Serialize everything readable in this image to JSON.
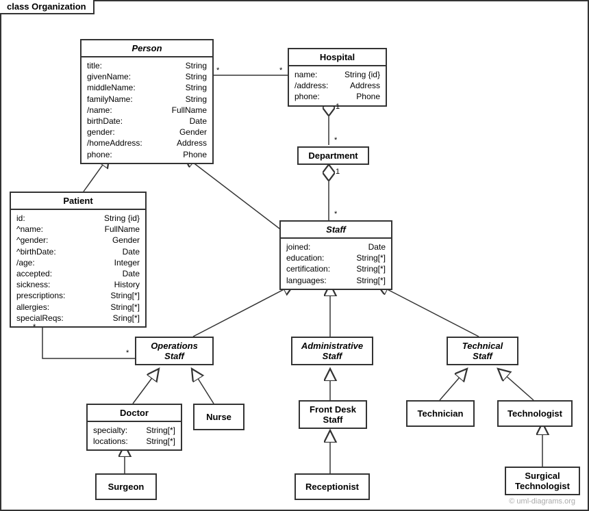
{
  "frame": {
    "title": "class Organization"
  },
  "watermark": "© uml-diagrams.org",
  "classes": {
    "person": {
      "name": "Person",
      "abstract": true,
      "attrs": [
        {
          "n": "title:",
          "t": "String"
        },
        {
          "n": "givenName:",
          "t": "String"
        },
        {
          "n": "middleName:",
          "t": "String"
        },
        {
          "n": "familyName:",
          "t": "String"
        },
        {
          "n": "/name:",
          "t": "FullName"
        },
        {
          "n": "birthDate:",
          "t": "Date"
        },
        {
          "n": "gender:",
          "t": "Gender"
        },
        {
          "n": "/homeAddress:",
          "t": "Address"
        },
        {
          "n": "phone:",
          "t": "Phone"
        }
      ]
    },
    "hospital": {
      "name": "Hospital",
      "attrs": [
        {
          "n": "name:",
          "t": "String {id}"
        },
        {
          "n": "/address:",
          "t": "Address"
        },
        {
          "n": "phone:",
          "t": "Phone"
        }
      ]
    },
    "department": {
      "name": "Department"
    },
    "patient": {
      "name": "Patient",
      "attrs": [
        {
          "n": "id:",
          "t": "String {id}"
        },
        {
          "n": "^name:",
          "t": "FullName"
        },
        {
          "n": "^gender:",
          "t": "Gender"
        },
        {
          "n": "^birthDate:",
          "t": "Date"
        },
        {
          "n": "/age:",
          "t": "Integer"
        },
        {
          "n": "accepted:",
          "t": "Date"
        },
        {
          "n": "sickness:",
          "t": "History"
        },
        {
          "n": "prescriptions:",
          "t": "String[*]"
        },
        {
          "n": "allergies:",
          "t": "String[*]"
        },
        {
          "n": "specialReqs:",
          "t": "Sring[*]"
        }
      ]
    },
    "staff": {
      "name": "Staff",
      "abstract": true,
      "attrs": [
        {
          "n": "joined:",
          "t": "Date"
        },
        {
          "n": "education:",
          "t": "String[*]"
        },
        {
          "n": "certification:",
          "t": "String[*]"
        },
        {
          "n": "languages:",
          "t": "String[*]"
        }
      ]
    },
    "opsStaff": {
      "name": "Operations\nStaff",
      "abstract": true
    },
    "adminStaff": {
      "name": "Administrative\nStaff",
      "abstract": true
    },
    "techStaff": {
      "name": "Technical\nStaff",
      "abstract": true
    },
    "doctor": {
      "name": "Doctor",
      "attrs": [
        {
          "n": "specialty:",
          "t": "String[*]"
        },
        {
          "n": "locations:",
          "t": "String[*]"
        }
      ]
    },
    "nurse": {
      "name": "Nurse"
    },
    "frontDesk": {
      "name": "Front Desk\nStaff"
    },
    "technician": {
      "name": "Technician"
    },
    "technologist": {
      "name": "Technologist"
    },
    "surgeon": {
      "name": "Surgeon"
    },
    "receptionist": {
      "name": "Receptionist"
    },
    "surgTech": {
      "name": "Surgical\nTechnologist"
    }
  },
  "mults": {
    "personHospL": "*",
    "personHospR": "*",
    "hospDept1": "1",
    "hospDeptS": "*",
    "deptStaff1": "1",
    "deptStaffS": "*",
    "patientOpsP": "*",
    "patientOpsO": "*"
  }
}
